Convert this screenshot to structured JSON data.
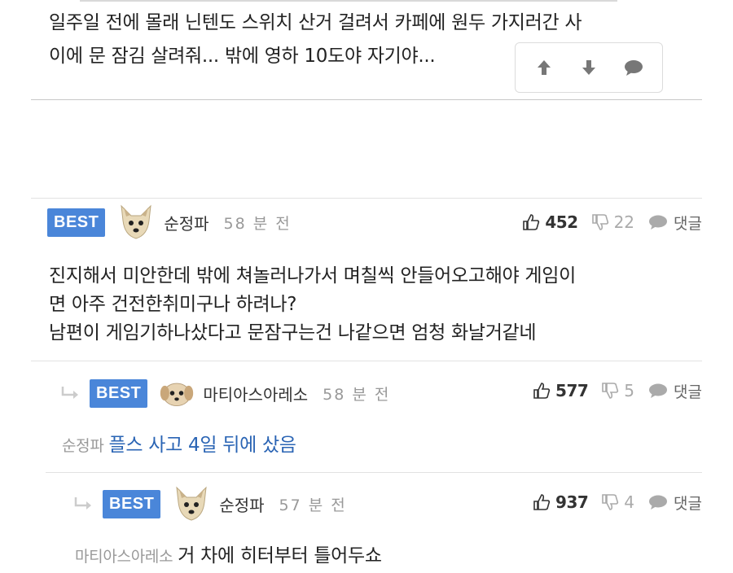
{
  "post": {
    "line1": "일주일 전에 몰래 닌텐도 스위치 산거 걸려서  카페에 원두 가지러간 사",
    "line2": "이에 문 잠김 살려줘... 밖에 영하 10도야 자기야...",
    "vote_icons": [
      "arrow-up-icon",
      "arrow-down-icon",
      "comment-bubble-icon"
    ]
  },
  "comments": [
    {
      "badge": "BEST",
      "nick": "순정파",
      "time": "58 분 전",
      "likes": "452",
      "dislikes": "22",
      "reply_label": "댓글",
      "lines": [
        "진지해서 미안한데 밖에 쳐놀러나가서 며칠씩 안들어오고해야 게임이",
        "면 아주 건전한취미구나 하려나?",
        "남편이 게임기하나샀다고 문잠구는건 나같으면 엄청 화날거같네"
      ]
    },
    {
      "badge": "BEST",
      "nick": "마티아스아레소",
      "time": "58 분 전",
      "likes": "577",
      "dislikes": "5",
      "reply_label": "댓글",
      "mention": "순정파",
      "text": "플스 사고 4일 뒤에 샀음"
    },
    {
      "badge": "BEST",
      "nick": "순정파",
      "time": "57 분 전",
      "likes": "937",
      "dislikes": "4",
      "reply_label": "댓글",
      "mention": "마티아스아레소",
      "text": "거 차에 히터부터 틀어두쇼"
    }
  ],
  "colors": {
    "badge": "#4a86d9",
    "reply_text": "#2a64b4"
  }
}
